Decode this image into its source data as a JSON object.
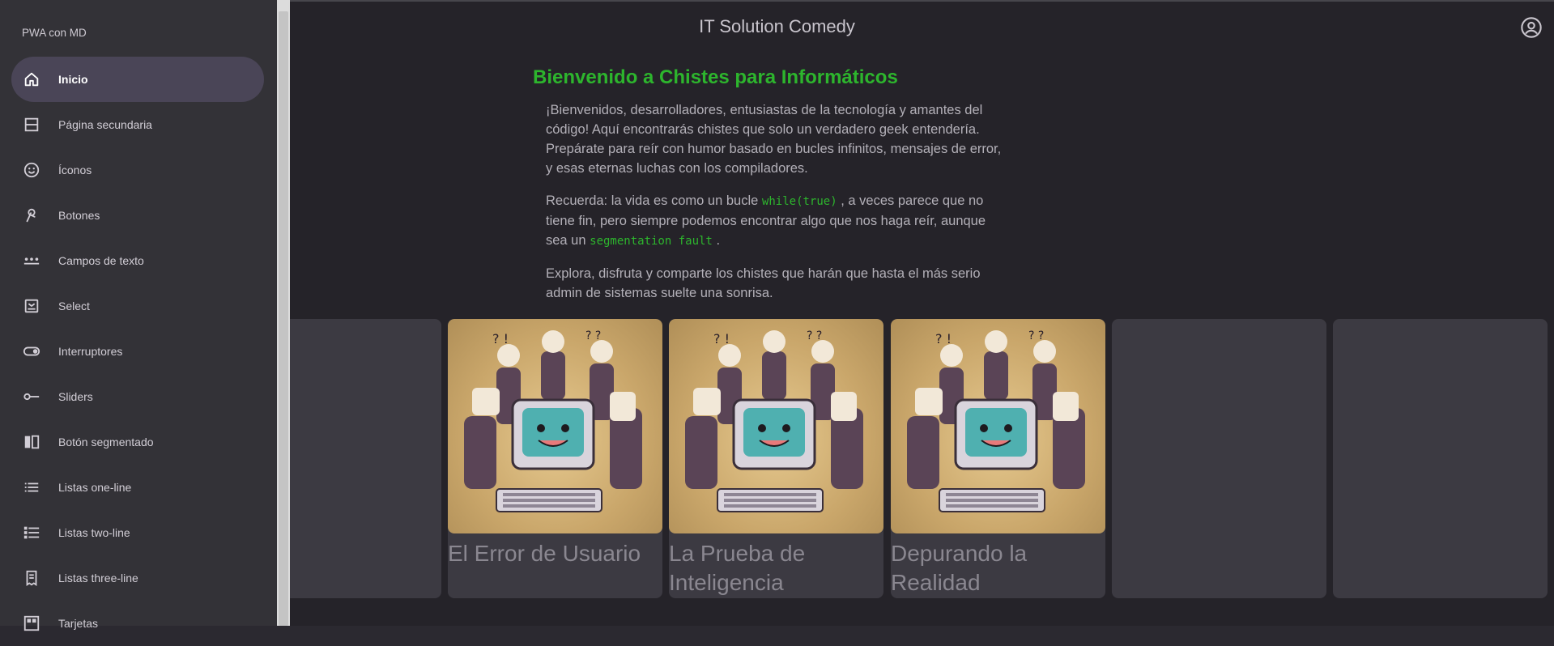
{
  "app": {
    "title": "IT Solution Comedy"
  },
  "drawer": {
    "header": "PWA con MD",
    "items": [
      {
        "label": "Inicio",
        "icon": "home-icon",
        "active": true
      },
      {
        "label": "Página secundaria",
        "icon": "page-icon"
      },
      {
        "label": "Íconos",
        "icon": "smiley-icon"
      },
      {
        "label": "Botones",
        "icon": "tap-icon"
      },
      {
        "label": "Campos de texto",
        "icon": "password-icon"
      },
      {
        "label": "Select",
        "icon": "select-icon"
      },
      {
        "label": "Interruptores",
        "icon": "toggle-icon"
      },
      {
        "label": "Sliders",
        "icon": "slider-icon"
      },
      {
        "label": "Botón segmentado",
        "icon": "segmented-icon"
      },
      {
        "label": "Listas one-line",
        "icon": "list-icon"
      },
      {
        "label": "Listas two-line",
        "icon": "list-bulleted-icon"
      },
      {
        "label": "Listas three-line",
        "icon": "receipt-icon"
      },
      {
        "label": "Tarjetas",
        "icon": "cards-icon"
      }
    ]
  },
  "main": {
    "heading": "Bienvenido a Chistes para Informáticos",
    "para1": "¡Bienvenidos, desarrolladores, entusiastas de la tecnología y amantes del código! Aquí encontrarás chistes que solo un verdadero geek entendería. Prepárate para reír con humor basado en bucles infinitos, mensajes de error, y esas eternas luchas con los compiladores.",
    "para2_a": "Recuerda: la vida es como un bucle",
    "para2_code1": "while(true)",
    "para2_b": ", a veces parece que no tiene fin, pero siempre podemos encontrar algo que nos haga reír, aunque sea un",
    "para2_code2": "segmentation fault",
    "para2_c": ".",
    "para3": "Explora, disfruta y comparte los chistes que harán que hasta el más serio admin de sistemas suelte una sonrisa."
  },
  "cards": [
    {
      "title": ""
    },
    {
      "title": "El Error de Usuario"
    },
    {
      "title": "La Prueba de Inteligencia"
    },
    {
      "title": "Depurando la Realidad"
    },
    {
      "title": ""
    },
    {
      "title": ""
    }
  ],
  "colors": {
    "accent": "#2db52d",
    "drawer": "#333237",
    "active": "#4a4557",
    "card": "#3c3a42"
  }
}
